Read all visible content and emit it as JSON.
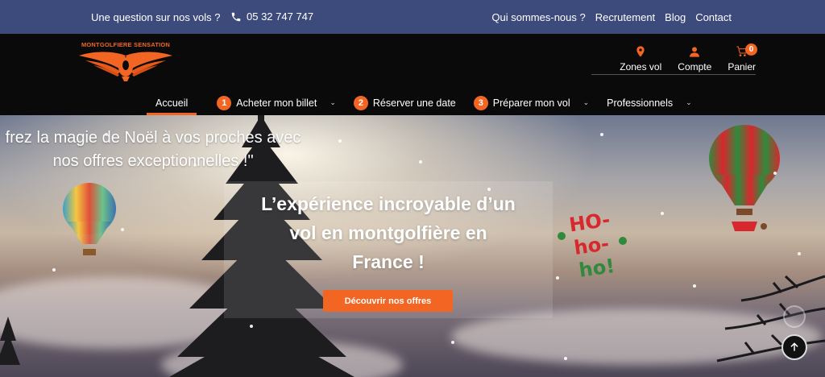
{
  "topbar": {
    "question": "Une question sur nos vols ?",
    "phone": "05 32 747 747",
    "links": [
      "Qui sommes-nous ?",
      "Recrutement",
      "Blog",
      "Contact"
    ]
  },
  "logo": {
    "text": "MONTGOLFIERE SENSATION"
  },
  "header_icons": {
    "zones": {
      "label": "Zones vol",
      "icon": "map-pin-icon"
    },
    "account": {
      "label": "Compte",
      "icon": "user-icon"
    },
    "cart": {
      "label": "Panier",
      "icon": "cart-icon",
      "count": "0"
    }
  },
  "nav": {
    "home": "Accueil",
    "buy": {
      "num": "1",
      "label": "Acheter mon billet"
    },
    "book": {
      "num": "2",
      "label": "Réserver une date"
    },
    "prepare": {
      "num": "3",
      "label": "Préparer mon vol"
    },
    "pro": "Professionnels"
  },
  "hero": {
    "promo_line1": "frez la magie de Noël à vos proches avec",
    "promo_line2": "nos offres exceptionnelles !\"",
    "headline_line1": "L’expérience incroyable d’un",
    "headline_line2": "vol en montgolfière en",
    "headline_line3": "France !",
    "cta": "Découvrir nos offres",
    "sticker_text": "HO-ho-ho!"
  },
  "colors": {
    "accent": "#f26522",
    "topbar": "#3d4a7c",
    "header": "#0a0a0a"
  }
}
